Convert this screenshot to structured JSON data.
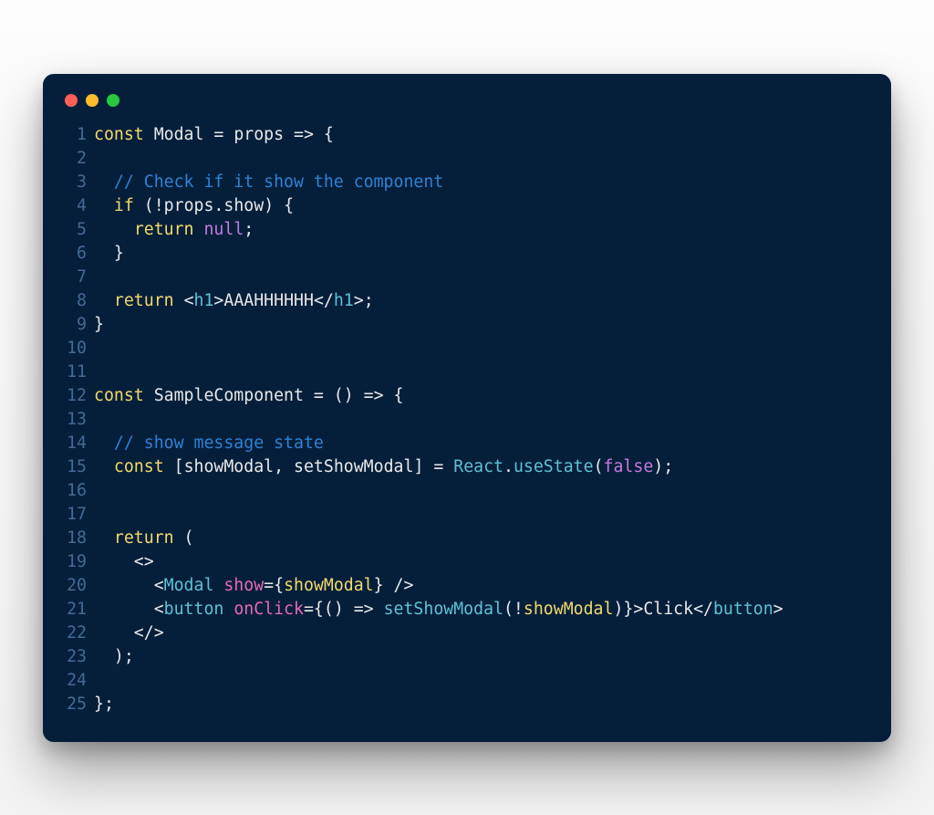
{
  "window": {
    "traffic_lights": [
      "close",
      "minimize",
      "zoom"
    ]
  },
  "code": {
    "lines": [
      {
        "n": 1,
        "tokens": [
          [
            "kw",
            "const "
          ],
          [
            "fn",
            "Modal"
          ],
          [
            "op",
            " = "
          ],
          [
            "pr",
            "props"
          ],
          [
            "op",
            " => {"
          ]
        ]
      },
      {
        "n": 2,
        "tokens": []
      },
      {
        "n": 3,
        "tokens": [
          [
            "op",
            "  "
          ],
          [
            "cm",
            "// Check if it show the component"
          ]
        ]
      },
      {
        "n": 4,
        "tokens": [
          [
            "op",
            "  "
          ],
          [
            "kw",
            "if"
          ],
          [
            "op",
            " (!"
          ],
          [
            "pr",
            "props"
          ],
          [
            "op",
            "."
          ],
          [
            "pr",
            "show"
          ],
          [
            "op",
            ") {"
          ]
        ]
      },
      {
        "n": 5,
        "tokens": [
          [
            "op",
            "    "
          ],
          [
            "kw",
            "return "
          ],
          [
            "null",
            "null"
          ],
          [
            "op",
            ";"
          ]
        ]
      },
      {
        "n": 6,
        "tokens": [
          [
            "op",
            "  }"
          ]
        ]
      },
      {
        "n": 7,
        "tokens": []
      },
      {
        "n": 8,
        "tokens": [
          [
            "op",
            "  "
          ],
          [
            "kw",
            "return "
          ],
          [
            "ang",
            "<"
          ],
          [
            "tag",
            "h1"
          ],
          [
            "ang",
            ">"
          ],
          [
            "str",
            "AAAHHHHHH"
          ],
          [
            "ang",
            "</"
          ],
          [
            "tag",
            "h1"
          ],
          [
            "ang",
            ">;"
          ]
        ]
      },
      {
        "n": 9,
        "tokens": [
          [
            "op",
            "}"
          ]
        ]
      },
      {
        "n": 10,
        "tokens": []
      },
      {
        "n": 11,
        "tokens": []
      },
      {
        "n": 12,
        "tokens": [
          [
            "kw",
            "const "
          ],
          [
            "fn",
            "SampleComponent"
          ],
          [
            "op",
            " = () => {"
          ]
        ]
      },
      {
        "n": 13,
        "tokens": []
      },
      {
        "n": 14,
        "tokens": [
          [
            "op",
            "  "
          ],
          [
            "cm",
            "// show message state"
          ]
        ]
      },
      {
        "n": 15,
        "tokens": [
          [
            "op",
            "  "
          ],
          [
            "kw",
            "const"
          ],
          [
            "op",
            " ["
          ],
          [
            "pr",
            "showModal"
          ],
          [
            "op",
            ", "
          ],
          [
            "pr",
            "setShowModal"
          ],
          [
            "op",
            "] = "
          ],
          [
            "call",
            "React"
          ],
          [
            "op",
            "."
          ],
          [
            "call",
            "useState"
          ],
          [
            "op",
            "("
          ],
          [
            "false",
            "false"
          ],
          [
            "op",
            ");"
          ]
        ]
      },
      {
        "n": 16,
        "tokens": []
      },
      {
        "n": 17,
        "tokens": []
      },
      {
        "n": 18,
        "tokens": [
          [
            "op",
            "  "
          ],
          [
            "kw",
            "return"
          ],
          [
            "op",
            " ("
          ]
        ]
      },
      {
        "n": 19,
        "tokens": [
          [
            "op",
            "    <>"
          ]
        ]
      },
      {
        "n": 20,
        "tokens": [
          [
            "op",
            "      "
          ],
          [
            "ang",
            "<"
          ],
          [
            "tag",
            "Modal"
          ],
          [
            "op",
            " "
          ],
          [
            "pnk",
            "show"
          ],
          [
            "op",
            "={"
          ],
          [
            "arg",
            "showModal"
          ],
          [
            "op",
            "} />"
          ]
        ]
      },
      {
        "n": 21,
        "tokens": [
          [
            "op",
            "      "
          ],
          [
            "ang",
            "<"
          ],
          [
            "tag",
            "button"
          ],
          [
            "op",
            " "
          ],
          [
            "pnk",
            "onClick"
          ],
          [
            "op",
            "={() => "
          ],
          [
            "call",
            "setShowModal"
          ],
          [
            "op",
            "(!"
          ],
          [
            "arg",
            "showModal"
          ],
          [
            "op",
            ")}>"
          ],
          [
            "str",
            "Click"
          ],
          [
            "ang",
            "</"
          ],
          [
            "tag",
            "button"
          ],
          [
            "ang",
            ">"
          ]
        ]
      },
      {
        "n": 22,
        "tokens": [
          [
            "op",
            "    </>"
          ]
        ]
      },
      {
        "n": 23,
        "tokens": [
          [
            "op",
            "  );"
          ]
        ]
      },
      {
        "n": 24,
        "tokens": []
      },
      {
        "n": 25,
        "tokens": [
          [
            "op",
            "};"
          ]
        ]
      }
    ]
  }
}
